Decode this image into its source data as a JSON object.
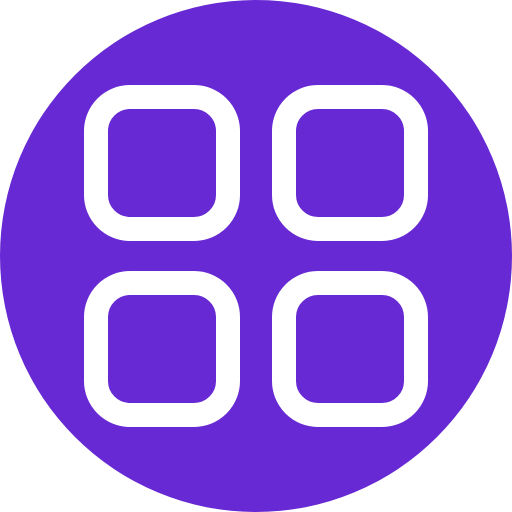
{
  "icon": {
    "name": "app-grid-icon",
    "background_color": "#6629D3",
    "stroke_color": "#FFFFFF"
  }
}
